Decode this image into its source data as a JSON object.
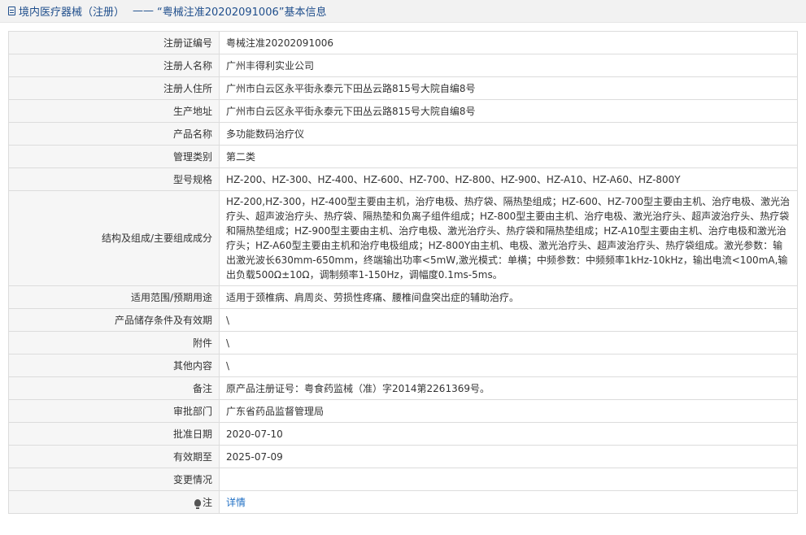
{
  "header": {
    "category": "境内医疗器械（注册）",
    "separator": "——",
    "title": "“粤械注准20202091006”基本信息"
  },
  "rows": [
    {
      "label": "注册证编号",
      "value": "粤械注准20202091006"
    },
    {
      "label": "注册人名称",
      "value": "广州丰得利实业公司"
    },
    {
      "label": "注册人住所",
      "value": "广州市白云区永平街永泰元下田丛云路815号大院自编8号"
    },
    {
      "label": "生产地址",
      "value": "广州市白云区永平街永泰元下田丛云路815号大院自编8号"
    },
    {
      "label": "产品名称",
      "value": "多功能数码治疗仪"
    },
    {
      "label": "管理类别",
      "value": "第二类"
    },
    {
      "label": "型号规格",
      "value": "HZ-200、HZ-300、HZ-400、HZ-600、HZ-700、HZ-800、HZ-900、HZ-A10、HZ-A60、HZ-800Y"
    },
    {
      "label": "结构及组成/主要组成成分",
      "value": "HZ-200,HZ-300，HZ-400型主要由主机，治疗电极、热疗袋、隔热垫组成；HZ-600、HZ-700型主要由主机、治疗电极、激光治疗头、超声波治疗头、热疗袋、隔热垫和负离子组件组成；HZ-800型主要由主机、治疗电极、激光治疗头、超声波治疗头、热疗袋和隔热垫组成；HZ-900型主要由主机、治疗电极、激光治疗头、热疗袋和隔热垫组成；HZ-A10型主要由主机、治疗电极和激光治疗头；HZ-A60型主要由主机和治疗电极组成；HZ-800Y由主机、电极、激光治疗头、超声波治疗头、热疗袋组成。激光参数：输出激光波长630mm-650mm，终端输出功率<5mW,激光模式：单横；中频参数：中频频率1kHz-10kHz，输出电流<100mA,输出负载500Ω±10Ω，调制频率1-150Hz，调幅度0.1ms-5ms。"
    },
    {
      "label": "适用范围/预期用途",
      "value": "适用于颈椎病、肩周炎、劳损性疼痛、腰椎间盘突出症的辅助治疗。"
    },
    {
      "label": "产品储存条件及有效期",
      "value": "\\"
    },
    {
      "label": "附件",
      "value": "\\"
    },
    {
      "label": "其他内容",
      "value": "\\"
    },
    {
      "label": "备注",
      "value": "原产品注册证号：粤食药监械（准）字2014第2261369号。"
    },
    {
      "label": "审批部门",
      "value": "广东省药品监督管理局"
    },
    {
      "label": "批准日期",
      "value": "2020-07-10"
    },
    {
      "label": "有效期至",
      "value": "2025-07-09"
    },
    {
      "label": "变更情况",
      "value": ""
    }
  ],
  "note": {
    "label": "注",
    "icon": "lightbulb-icon",
    "link_text": "详情"
  }
}
